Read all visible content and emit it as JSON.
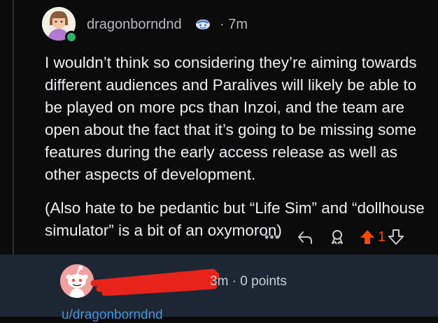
{
  "comment": {
    "username": "dragonborndnd",
    "time_ago": "· 7m",
    "paragraphs": [
      "I wouldn’t think so considering they’re aiming towards different audiences and Paralives will likely be able to be played on more pcs than Inzoi, and the team are open about the fact that it’s going to be missing some features during the early access release as well as other aspects of development.",
      "(Also hate to be pedantic but “Life Sim” and “dollhouse simulator” is a bit of an oxymoron)"
    ],
    "actions": {
      "more": "•••",
      "vote_count": "1"
    }
  },
  "reply": {
    "meta": "3m · 0 points",
    "mention": "u/dragonborndnd"
  },
  "colors": {
    "upvote": "#ff4500",
    "online": "#2fb36b",
    "link": "#4a90d9",
    "redaction": "#e8231c"
  }
}
